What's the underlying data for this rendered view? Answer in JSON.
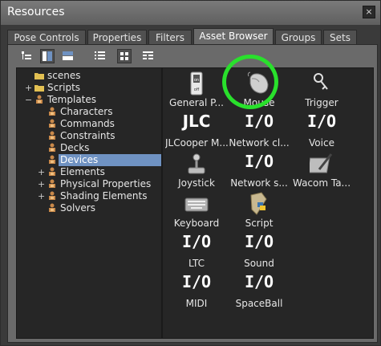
{
  "window": {
    "title": "Resources",
    "close_glyph": "×"
  },
  "tabs": [
    {
      "label": "Pose Controls",
      "active": false
    },
    {
      "label": "Properties",
      "active": false
    },
    {
      "label": "Filters",
      "active": false
    },
    {
      "label": "Asset Browser",
      "active": true
    },
    {
      "label": "Groups",
      "active": false
    },
    {
      "label": "Sets",
      "active": false
    }
  ],
  "toolbar": {
    "buttons": [
      {
        "name": "tree-view-icon",
        "pressed": false
      },
      {
        "name": "split-view-icon",
        "pressed": true
      },
      {
        "name": "stacked-view-icon",
        "pressed": false
      },
      {
        "name": "list-view-icon",
        "pressed": false
      },
      {
        "name": "icon-view-icon",
        "pressed": true
      },
      {
        "name": "detail-view-icon",
        "pressed": false
      }
    ]
  },
  "tree": [
    {
      "label": "scenes",
      "icon": "folder-icon",
      "level": 0,
      "expander": ""
    },
    {
      "label": "Scripts",
      "icon": "folder-icon",
      "level": 0,
      "expander": "+"
    },
    {
      "label": "Templates",
      "icon": "templates-icon",
      "level": 0,
      "expander": "−"
    },
    {
      "label": "Characters",
      "icon": "templates-icon",
      "level": 1,
      "expander": ""
    },
    {
      "label": "Commands",
      "icon": "templates-icon",
      "level": 1,
      "expander": ""
    },
    {
      "label": "Constraints",
      "icon": "templates-icon",
      "level": 1,
      "expander": ""
    },
    {
      "label": "Decks",
      "icon": "templates-icon",
      "level": 1,
      "expander": ""
    },
    {
      "label": "Devices",
      "icon": "templates-icon",
      "level": 1,
      "expander": "",
      "selected": true
    },
    {
      "label": "Elements",
      "icon": "templates-icon",
      "level": 1,
      "expander": "+"
    },
    {
      "label": "Physical Properties",
      "icon": "templates-icon",
      "level": 1,
      "expander": "+"
    },
    {
      "label": "Shading Elements",
      "icon": "templates-icon",
      "level": 1,
      "expander": "+"
    },
    {
      "label": "Solvers",
      "icon": "templates-icon",
      "level": 1,
      "expander": ""
    }
  ],
  "assets": [
    {
      "label": "General P...",
      "icon": "switch-icon"
    },
    {
      "label": "Mouse",
      "icon": "mouse-icon",
      "highlighted": true
    },
    {
      "label": "Trigger",
      "icon": "trigger-icon"
    },
    {
      "label": "JLCooper M...",
      "text_icon": "JLC"
    },
    {
      "label": "Network cl...",
      "text_icon": "I/O"
    },
    {
      "label": "Voice",
      "text_icon": "I/O"
    },
    {
      "label": "Joystick",
      "icon": "joystick-icon"
    },
    {
      "label": "Network s...",
      "text_icon": "I/O"
    },
    {
      "label": "Wacom Ta...",
      "icon": "tablet-icon"
    },
    {
      "label": "Keyboard",
      "icon": "keyboard-icon"
    },
    {
      "label": "Script",
      "icon": "python-icon"
    },
    {
      "label": "LTC",
      "text_icon": "I/O"
    },
    {
      "label": "Sound",
      "text_icon": "I/O"
    },
    {
      "label": "MIDI",
      "text_icon": "I/O"
    },
    {
      "label": "SpaceBall",
      "text_icon": "I/O"
    }
  ],
  "colors": {
    "highlight_ring": "#29e02c",
    "selection": "#6f92c2"
  }
}
